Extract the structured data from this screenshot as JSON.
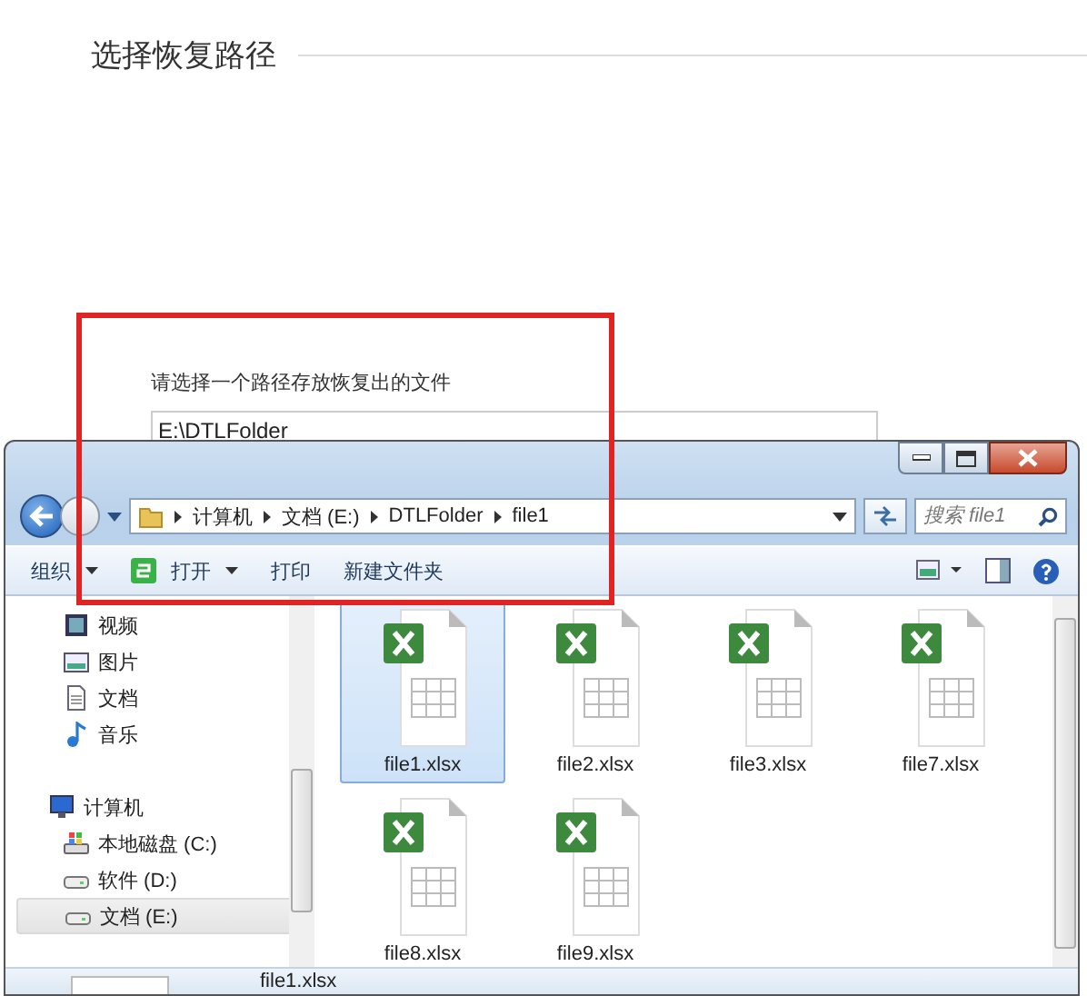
{
  "page": {
    "title": "选择恢复路径",
    "path_label": "请选择一个路径存放恢复出的文件",
    "path_field": {
      "value": "E:\\DTLFolder"
    }
  },
  "explorer": {
    "breadcrumb": [
      "计算机",
      "文档 (E:)",
      "DTLFolder",
      "file1"
    ],
    "search": {
      "placeholder": "搜索 file1"
    },
    "toolbar": [
      {
        "label": "组织",
        "kind": "menu"
      },
      {
        "label": "打开",
        "kind": "open"
      },
      {
        "label": "打印",
        "kind": "plain"
      },
      {
        "label": "新建文件夹",
        "kind": "plain"
      }
    ],
    "sidebar": [
      {
        "label": "视频",
        "kind": "video",
        "selected": false
      },
      {
        "label": "图片",
        "kind": "picture",
        "selected": false
      },
      {
        "label": "文档",
        "kind": "document",
        "selected": false
      },
      {
        "label": "音乐",
        "kind": "music",
        "selected": false
      },
      {
        "label": "计算机",
        "kind": "computer",
        "selected": false,
        "children": [
          {
            "label": "本地磁盘 (C:)",
            "kind": "system-drive",
            "selected": false
          },
          {
            "label": "软件 (D:)",
            "kind": "drive",
            "selected": false
          },
          {
            "label": "文档 (E:)",
            "kind": "drive",
            "selected": true
          }
        ]
      }
    ],
    "files": [
      {
        "name": "file1.xlsx",
        "selected": true
      },
      {
        "name": "file2.xlsx",
        "selected": false
      },
      {
        "name": "file3.xlsx",
        "selected": false
      },
      {
        "name": "file7.xlsx",
        "selected": false
      },
      {
        "name": "file8.xlsx",
        "selected": false
      },
      {
        "name": "file9.xlsx",
        "selected": false
      }
    ],
    "details": {
      "name": "file1.xlsx"
    }
  }
}
